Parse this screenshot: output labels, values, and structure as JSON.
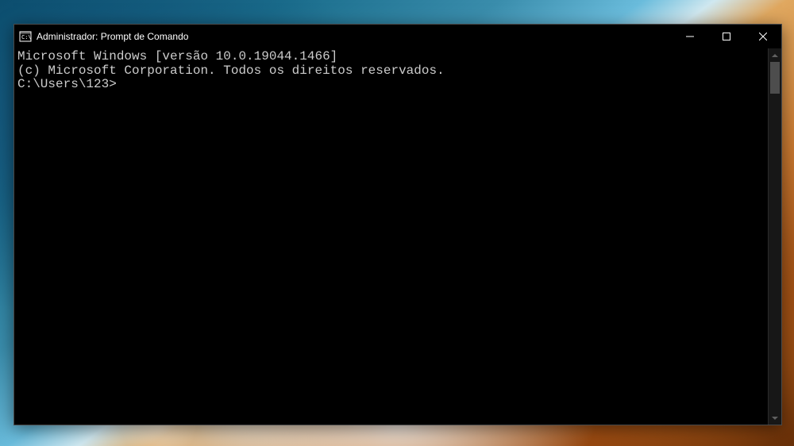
{
  "window": {
    "title": "Administrador: Prompt de Comando"
  },
  "terminal": {
    "line1": "Microsoft Windows [versão 10.0.19044.1466]",
    "line2": "(c) Microsoft Corporation. Todos os direitos reservados.",
    "line3": "",
    "prompt": "C:\\Users\\123>"
  }
}
